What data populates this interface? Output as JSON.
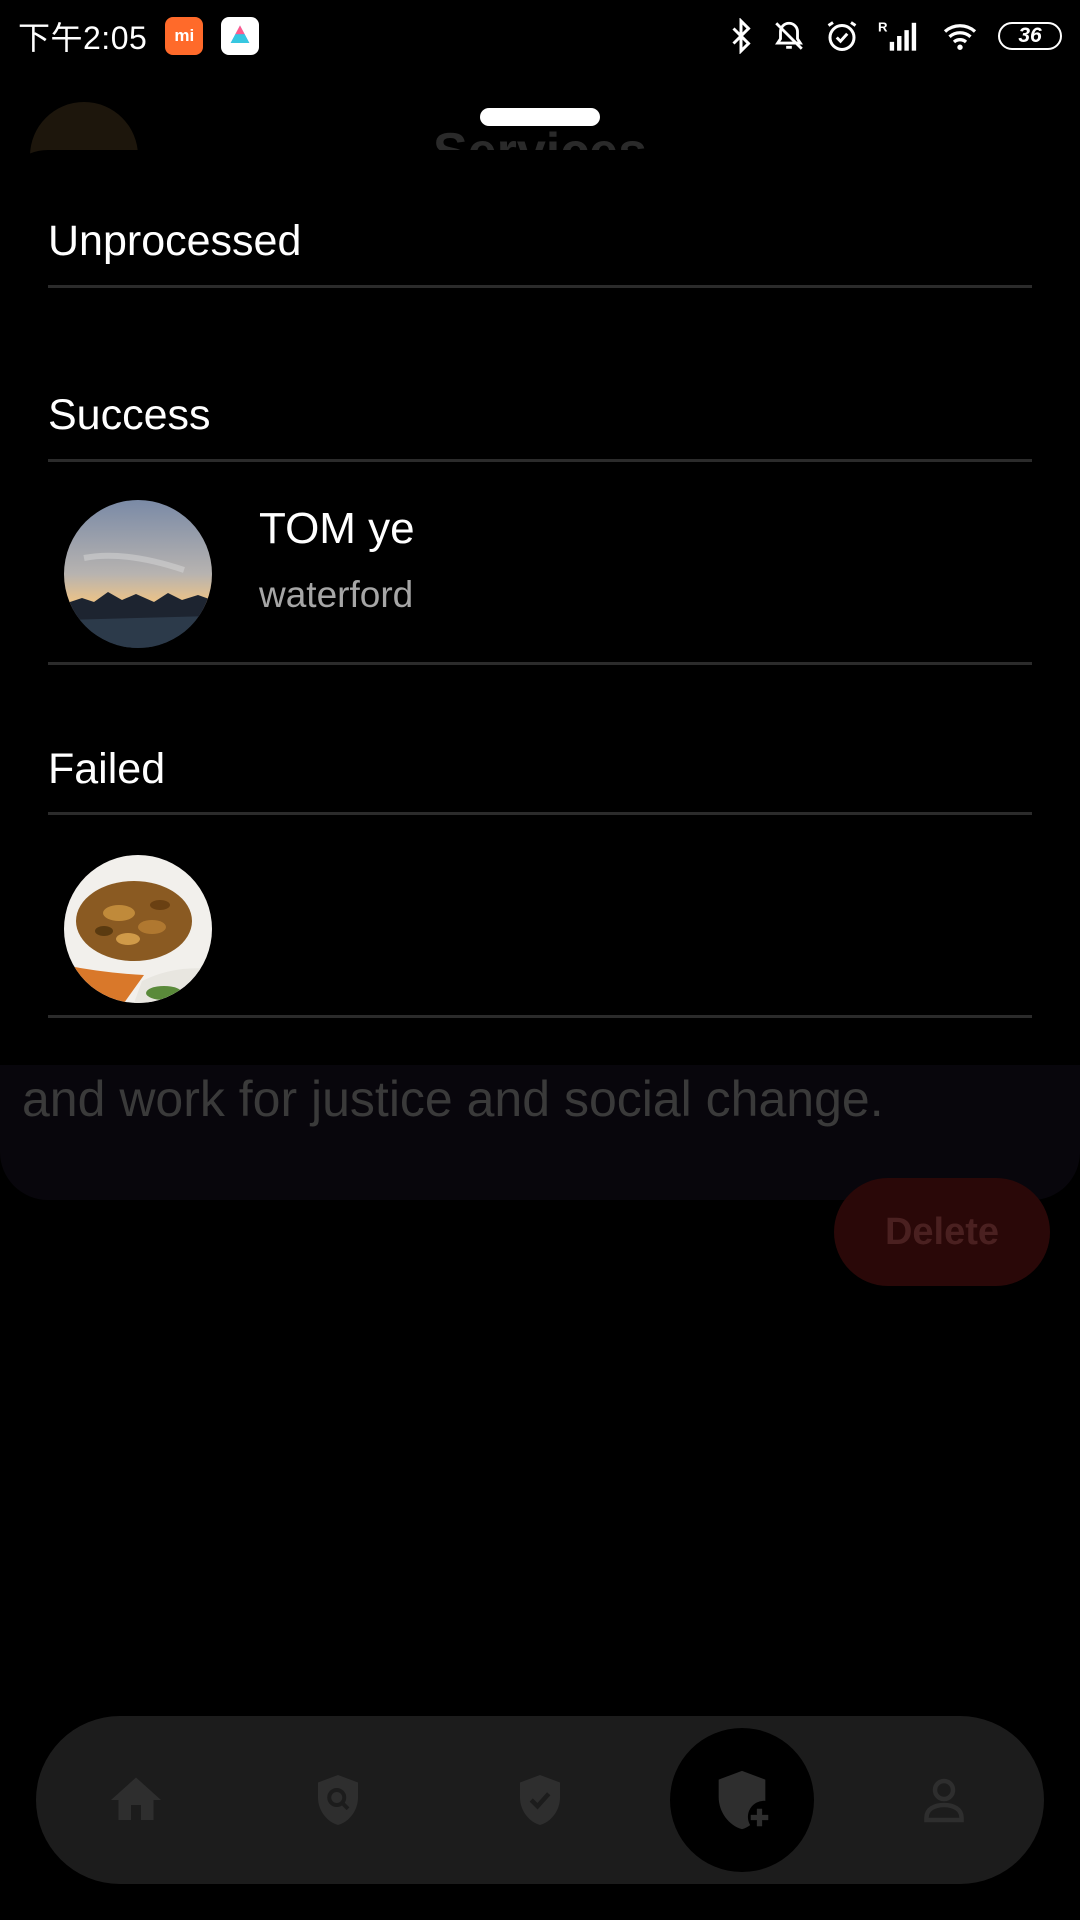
{
  "status_bar": {
    "time": "下午2:05",
    "app_icon_1": "mi-icon",
    "app_icon_2": "pinwheel-app-icon",
    "battery": "36",
    "icons": [
      "bluetooth-icon",
      "bell-off-icon",
      "alarm-icon",
      "cellular-signal-icon",
      "wifi-icon",
      "battery-icon"
    ]
  },
  "background": {
    "title": "Services",
    "card_text": "and work for justice and social change.",
    "delete_label": "Delete",
    "nav": [
      "home-icon",
      "search-shield-icon",
      "check-shield-icon",
      "add-shield-icon",
      "person-icon"
    ]
  },
  "sheet": {
    "sections": [
      {
        "title": "Unprocessed",
        "items": []
      },
      {
        "title": "Success",
        "items": [
          {
            "name": "TOM ye",
            "subtitle": "waterford",
            "avatar": "sunset-landscape-photo"
          }
        ]
      },
      {
        "title": "Failed",
        "items": [
          {
            "name": "",
            "subtitle": "",
            "avatar": "food-plate-photo"
          }
        ]
      }
    ]
  },
  "colors": {
    "background": "#000000",
    "divider": "#2b2b2b",
    "subtitle": "#a6a6a6",
    "delete_bg": "#2a0808",
    "nav_bg": "#1c1c1c",
    "mi_orange": "#ff6a2a"
  }
}
